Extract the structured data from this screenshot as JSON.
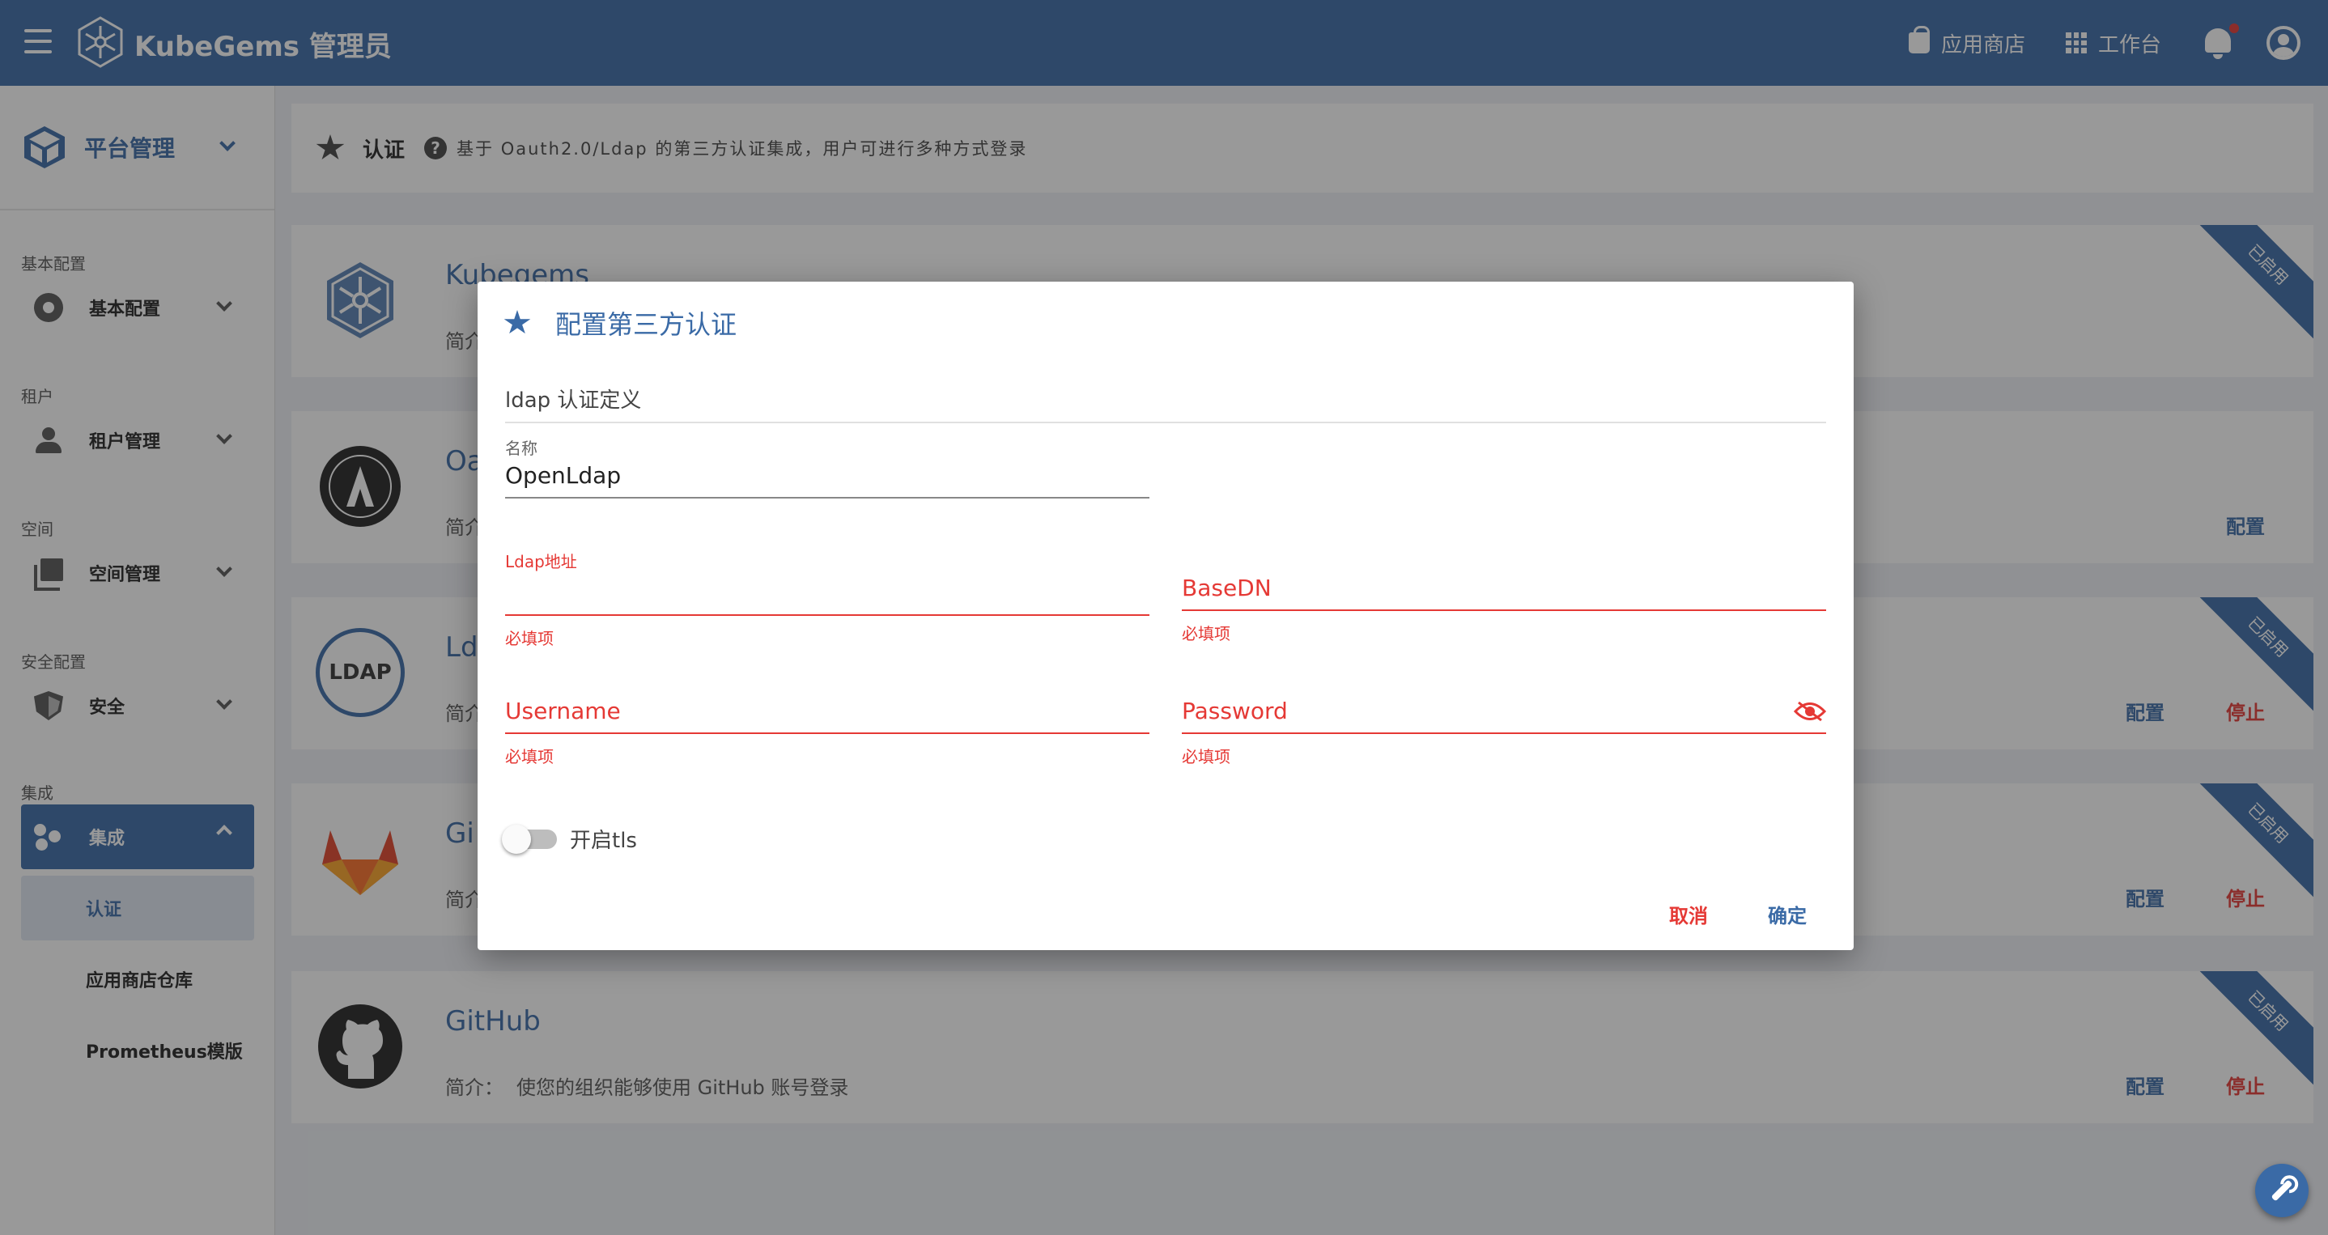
{
  "topbar": {
    "brand": "KubeGems 管理员",
    "app_store": "应用商店",
    "workbench": "工作台"
  },
  "sidebar": {
    "header": "平台管理",
    "groups": [
      {
        "label": "基本配置",
        "item": "基本配置"
      },
      {
        "label": "租户",
        "item": "租户管理"
      },
      {
        "label": "空间",
        "item": "空间管理"
      },
      {
        "label": "安全配置",
        "item": "安全"
      },
      {
        "label": "集成",
        "item": "集成"
      }
    ],
    "subitems": [
      "认证",
      "应用商店仓库",
      "Prometheus模版"
    ]
  },
  "main": {
    "title": "认证",
    "description": "基于 Oauth2.0/Ldap 的第三方认证集成，用户可进行多种方式登录",
    "cards": [
      {
        "title": "Kubegems",
        "desc_label": "简介",
        "ribbon": "已启用"
      },
      {
        "title": "Oa",
        "desc_label": "简介",
        "configure": "配置"
      },
      {
        "title": "Ld",
        "desc_label": "简介",
        "ribbon": "已启用",
        "configure": "配置",
        "stop": "停止"
      },
      {
        "title": "Gi",
        "desc_label": "简介",
        "ribbon": "已启用",
        "configure": "配置",
        "stop": "停止"
      },
      {
        "title": "GitHub",
        "desc_label": "简介：",
        "desc": "使您的组织能够使用 GitHub 账号登录",
        "ribbon": "已启用",
        "configure": "配置",
        "stop": "停止"
      }
    ],
    "ldap_logo_text": "LDAP"
  },
  "dialog": {
    "title": "配置第三方认证",
    "section": "ldap 认证定义",
    "name_label": "名称",
    "name_value": "OpenLdap",
    "ldap_addr_label": "Ldap地址",
    "basedn_placeholder": "BaseDN",
    "username_placeholder": "Username",
    "password_placeholder": "Password",
    "required_hint": "必填项",
    "tls_label": "开启tls",
    "tls_enabled": false,
    "cancel": "取消",
    "confirm": "确定"
  },
  "colors": {
    "primary": "#3a6aa6",
    "error": "#e53935"
  }
}
